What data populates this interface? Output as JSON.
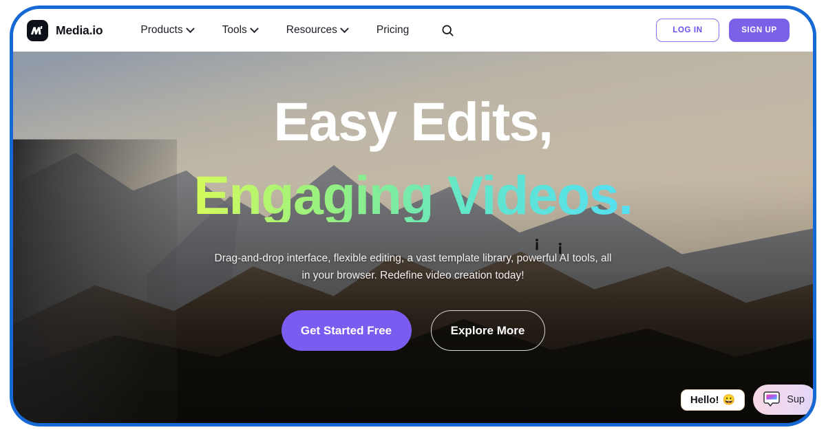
{
  "frame": {
    "border_color": "#1668d4"
  },
  "header": {
    "brand": {
      "name": "Media.io",
      "logo_icon": "media-io-logo-icon"
    },
    "nav": [
      {
        "label": "Products",
        "has_dropdown": true
      },
      {
        "label": "Tools",
        "has_dropdown": true
      },
      {
        "label": "Resources",
        "has_dropdown": true
      },
      {
        "label": "Pricing",
        "has_dropdown": false
      }
    ],
    "search_icon": "search-icon",
    "login_label": "LOG IN",
    "signup_label": "SIGN UP",
    "accent_purple": "#7b61e8"
  },
  "hero": {
    "headline_line1": "Easy Edits,",
    "headline_line2": "Engaging Videos.",
    "headline_gradient_from": "#d6fb5c",
    "headline_gradient_to": "#55dff3",
    "subhead_line1": "Drag-and-drop interface, flexible editing, a vast template library, powerful AI tools, all",
    "subhead_line2": "in your browser. Redefine video creation today!",
    "cta_primary": "Get Started Free",
    "cta_secondary": "Explore More",
    "cta_primary_color": "#7b5cf0"
  },
  "chat": {
    "hello_text": "Hello!",
    "hello_emoji": "😀",
    "support_label": "Sup",
    "support_icon": "chat-bubble-icon"
  }
}
